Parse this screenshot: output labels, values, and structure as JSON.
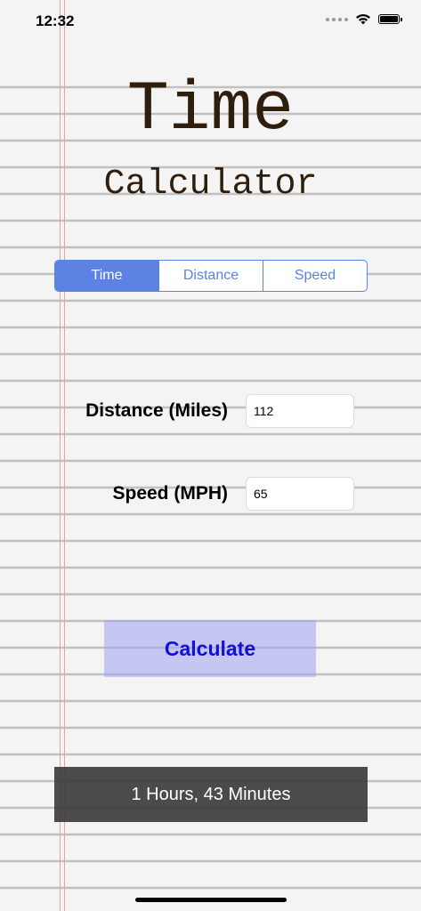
{
  "status_bar": {
    "time": "12:32",
    "icons": [
      "signal-dots-icon",
      "wifi-icon",
      "battery-icon"
    ]
  },
  "header": {
    "title": "Time",
    "subtitle": "Calculator"
  },
  "segmented_control": {
    "segments": [
      "Time",
      "Distance",
      "Speed"
    ],
    "selected": "Time"
  },
  "form": {
    "distance": {
      "label": "Distance (Miles)",
      "value": "112"
    },
    "speed": {
      "label": "Speed (MPH)",
      "value": "65"
    }
  },
  "calculate_button": {
    "label": "Calculate"
  },
  "result": {
    "text": "1 Hours, 43 Minutes"
  },
  "colors": {
    "accent": "#5c82e3",
    "title_text": "#2f1e0b",
    "button_text": "#1010d8",
    "result_background": "#3c3c3c"
  }
}
